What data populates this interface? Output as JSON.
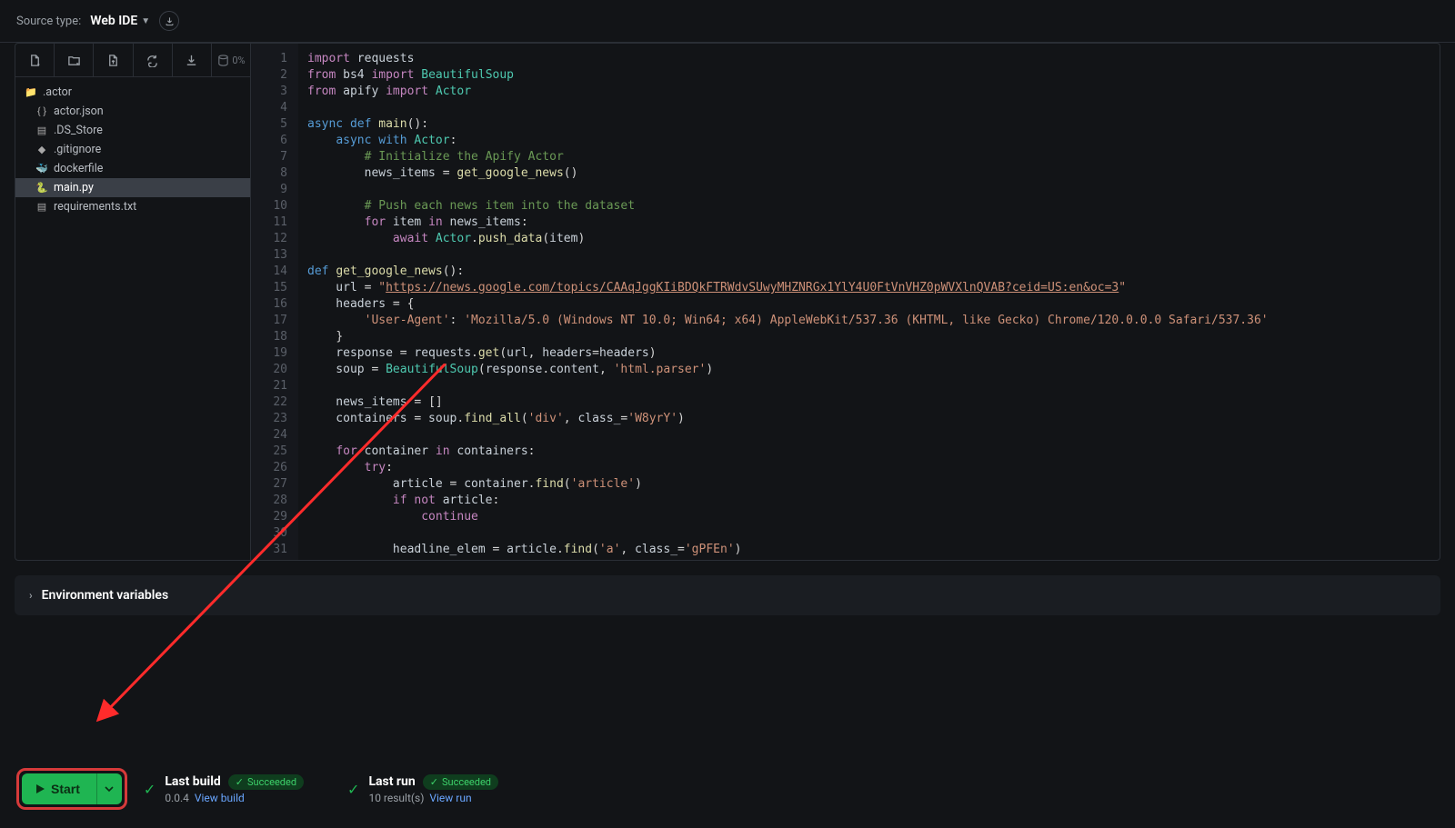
{
  "header": {
    "source_label": "Source type:",
    "source_type": "Web IDE"
  },
  "sidebar": {
    "storage_pct": "0%",
    "files": [
      {
        "name": ".actor",
        "icon": "folder"
      },
      {
        "name": "actor.json",
        "icon": "json"
      },
      {
        "name": ".DS_Store",
        "icon": "file"
      },
      {
        "name": ".gitignore",
        "icon": "git"
      },
      {
        "name": "dockerfile",
        "icon": "docker"
      },
      {
        "name": "main.py",
        "icon": "python",
        "selected": true
      },
      {
        "name": "requirements.txt",
        "icon": "txt"
      }
    ]
  },
  "editor": {
    "filename": "main.py",
    "lines": [
      [
        [
          "kw",
          "import"
        ],
        [
          "",
          " "
        ],
        [
          "",
          "requests"
        ]
      ],
      [
        [
          "kw",
          "from"
        ],
        [
          "",
          " bs4 "
        ],
        [
          "kw",
          "import"
        ],
        [
          "",
          " "
        ],
        [
          "cls",
          "BeautifulSoup"
        ]
      ],
      [
        [
          "kw",
          "from"
        ],
        [
          "",
          " apify "
        ],
        [
          "kw",
          "import"
        ],
        [
          "",
          " "
        ],
        [
          "cls",
          "Actor"
        ]
      ],
      [],
      [
        [
          "kw2",
          "async"
        ],
        [
          "",
          " "
        ],
        [
          "kw2",
          "def"
        ],
        [
          "",
          " "
        ],
        [
          "fn",
          "main"
        ],
        [
          "op",
          "():"
        ]
      ],
      [
        [
          "",
          "    "
        ],
        [
          "kw2",
          "async"
        ],
        [
          "",
          " "
        ],
        [
          "kw2",
          "with"
        ],
        [
          "",
          " "
        ],
        [
          "cls",
          "Actor"
        ],
        [
          "op",
          ":"
        ]
      ],
      [
        [
          "",
          "        "
        ],
        [
          "com",
          "# Initialize the Apify Actor"
        ]
      ],
      [
        [
          "",
          "        news_items "
        ],
        [
          "op",
          "="
        ],
        [
          "",
          " "
        ],
        [
          "fn",
          "get_google_news"
        ],
        [
          "op",
          "()"
        ]
      ],
      [],
      [
        [
          "",
          "        "
        ],
        [
          "com",
          "# Push each news item into the dataset"
        ]
      ],
      [
        [
          "",
          "        "
        ],
        [
          "kw",
          "for"
        ],
        [
          "",
          " item "
        ],
        [
          "kw",
          "in"
        ],
        [
          "",
          " news_items"
        ],
        [
          "op",
          ":"
        ]
      ],
      [
        [
          "",
          "            "
        ],
        [
          "kw",
          "await"
        ],
        [
          "",
          " "
        ],
        [
          "cls",
          "Actor"
        ],
        [
          "op",
          "."
        ],
        [
          "fn",
          "push_data"
        ],
        [
          "op",
          "("
        ],
        [
          "",
          "item"
        ],
        [
          "op",
          ")"
        ]
      ],
      [],
      [
        [
          "kw2",
          "def"
        ],
        [
          "",
          " "
        ],
        [
          "fn",
          "get_google_news"
        ],
        [
          "op",
          "():"
        ]
      ],
      [
        [
          "",
          "    url "
        ],
        [
          "op",
          "="
        ],
        [
          "",
          " "
        ],
        [
          "str",
          "\""
        ],
        [
          "url",
          "https://news.google.com/topics/CAAqJggKIiBDQkFTRWdvSUwyMHZNRGx1YlY4U0FtVnVHZ0pWVXlnQVAB?ceid=US:en&oc=3"
        ],
        [
          "str",
          "\""
        ]
      ],
      [
        [
          "",
          "    headers "
        ],
        [
          "op",
          "="
        ],
        [
          "",
          " "
        ],
        [
          "op",
          "{"
        ]
      ],
      [
        [
          "",
          "        "
        ],
        [
          "str",
          "'User-Agent'"
        ],
        [
          "op",
          ":"
        ],
        [
          "",
          " "
        ],
        [
          "str",
          "'Mozilla/5.0 (Windows NT 10.0; Win64; x64) AppleWebKit/537.36 (KHTML, like Gecko) Chrome/120.0.0.0 Safari/537.36'"
        ]
      ],
      [
        [
          "",
          "    "
        ],
        [
          "op",
          "}"
        ]
      ],
      [
        [
          "",
          "    response "
        ],
        [
          "op",
          "="
        ],
        [
          "",
          " requests"
        ],
        [
          "op",
          "."
        ],
        [
          "fn",
          "get"
        ],
        [
          "op",
          "("
        ],
        [
          "",
          "url"
        ],
        [
          "op",
          ","
        ],
        [
          "",
          " headers"
        ],
        [
          "op",
          "="
        ],
        [
          "",
          "headers"
        ],
        [
          "op",
          ")"
        ]
      ],
      [
        [
          "",
          "    soup "
        ],
        [
          "op",
          "="
        ],
        [
          "",
          " "
        ],
        [
          "cls",
          "BeautifulSoup"
        ],
        [
          "op",
          "("
        ],
        [
          "",
          "response"
        ],
        [
          "op",
          "."
        ],
        [
          "",
          "content"
        ],
        [
          "op",
          ","
        ],
        [
          "",
          " "
        ],
        [
          "str",
          "'html.parser'"
        ],
        [
          "op",
          ")"
        ]
      ],
      [],
      [
        [
          "",
          "    news_items "
        ],
        [
          "op",
          "="
        ],
        [
          "",
          " "
        ],
        [
          "op",
          "[]"
        ]
      ],
      [
        [
          "",
          "    containers "
        ],
        [
          "op",
          "="
        ],
        [
          "",
          " soup"
        ],
        [
          "op",
          "."
        ],
        [
          "fn",
          "find_all"
        ],
        [
          "op",
          "("
        ],
        [
          "str",
          "'div'"
        ],
        [
          "op",
          ","
        ],
        [
          "",
          " class_"
        ],
        [
          "op",
          "="
        ],
        [
          "str",
          "'W8yrY'"
        ],
        [
          "op",
          ")"
        ]
      ],
      [],
      [
        [
          "",
          "    "
        ],
        [
          "kw",
          "for"
        ],
        [
          "",
          " container "
        ],
        [
          "kw",
          "in"
        ],
        [
          "",
          " containers"
        ],
        [
          "op",
          ":"
        ]
      ],
      [
        [
          "",
          "        "
        ],
        [
          "kw",
          "try"
        ],
        [
          "op",
          ":"
        ]
      ],
      [
        [
          "",
          "            article "
        ],
        [
          "op",
          "="
        ],
        [
          "",
          " container"
        ],
        [
          "op",
          "."
        ],
        [
          "fn",
          "find"
        ],
        [
          "op",
          "("
        ],
        [
          "str",
          "'article'"
        ],
        [
          "op",
          ")"
        ]
      ],
      [
        [
          "",
          "            "
        ],
        [
          "kw",
          "if"
        ],
        [
          "",
          " "
        ],
        [
          "kw",
          "not"
        ],
        [
          "",
          " article"
        ],
        [
          "op",
          ":"
        ]
      ],
      [
        [
          "",
          "                "
        ],
        [
          "kw",
          "continue"
        ]
      ],
      [],
      [
        [
          "",
          "            headline_elem "
        ],
        [
          "op",
          "="
        ],
        [
          "",
          " article"
        ],
        [
          "op",
          "."
        ],
        [
          "fn",
          "find"
        ],
        [
          "op",
          "("
        ],
        [
          "str",
          "'a'"
        ],
        [
          "op",
          ","
        ],
        [
          "",
          " class_"
        ],
        [
          "op",
          "="
        ],
        [
          "str",
          "'gPFEn'"
        ],
        [
          "op",
          ")"
        ]
      ]
    ]
  },
  "env_section": {
    "title": "Environment variables"
  },
  "footer": {
    "start_label": "Start",
    "last_build": {
      "label": "Last build",
      "status": "Succeeded",
      "version": "0.0.4",
      "link": "View build"
    },
    "last_run": {
      "label": "Last run",
      "status": "Succeeded",
      "results": "10 result(s)",
      "link": "View run"
    }
  }
}
